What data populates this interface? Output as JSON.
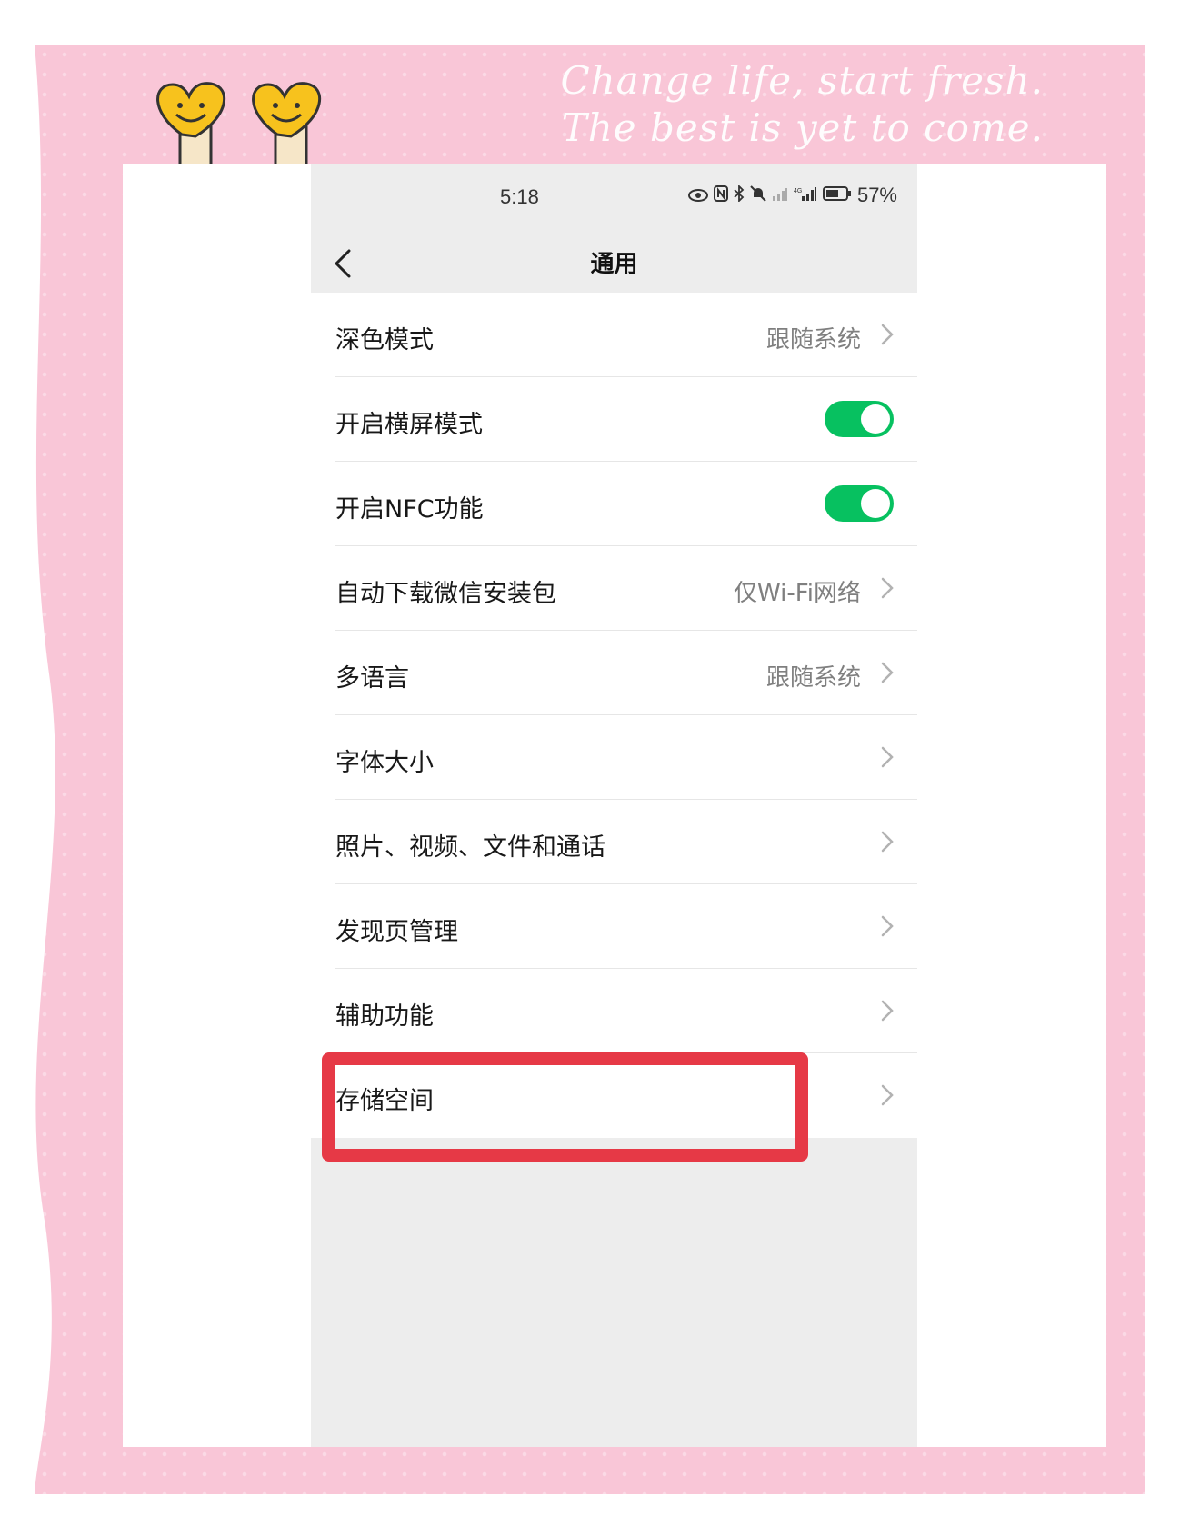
{
  "decoration": {
    "slogan_line_1": "Change life, start fresh.",
    "slogan_line_2": "The best is yet to come.",
    "frame_color": "#f9c6d7",
    "highlight_color": "#e63946"
  },
  "status_bar": {
    "time": "5:18",
    "battery": "57%",
    "icons": [
      "eye-icon",
      "nfc-icon",
      "bluetooth-icon",
      "mute-icon",
      "signal-1-icon",
      "signal-2-icon",
      "battery-icon"
    ]
  },
  "nav": {
    "title": "通用",
    "back_icon": "chevron-left-icon"
  },
  "settings": [
    {
      "label": "深色模式",
      "value": "跟随系统",
      "type": "link"
    },
    {
      "label": "开启横屏模式",
      "value": "",
      "type": "toggle",
      "on": true
    },
    {
      "label": "开启NFC功能",
      "value": "",
      "type": "toggle",
      "on": true
    },
    {
      "label": "自动下载微信安装包",
      "value": "仅Wi-Fi网络",
      "type": "link"
    },
    {
      "label": "多语言",
      "value": "跟随系统",
      "type": "link"
    },
    {
      "label": "字体大小",
      "value": "",
      "type": "link"
    },
    {
      "label": "照片、视频、文件和通话",
      "value": "",
      "type": "link"
    },
    {
      "label": "发现页管理",
      "value": "",
      "type": "link"
    },
    {
      "label": "辅助功能",
      "value": "",
      "type": "link"
    },
    {
      "label": "存储空间",
      "value": "",
      "type": "link",
      "highlighted": true
    }
  ],
  "colors": {
    "toggle_on": "#07c160",
    "background": "#ededed"
  }
}
